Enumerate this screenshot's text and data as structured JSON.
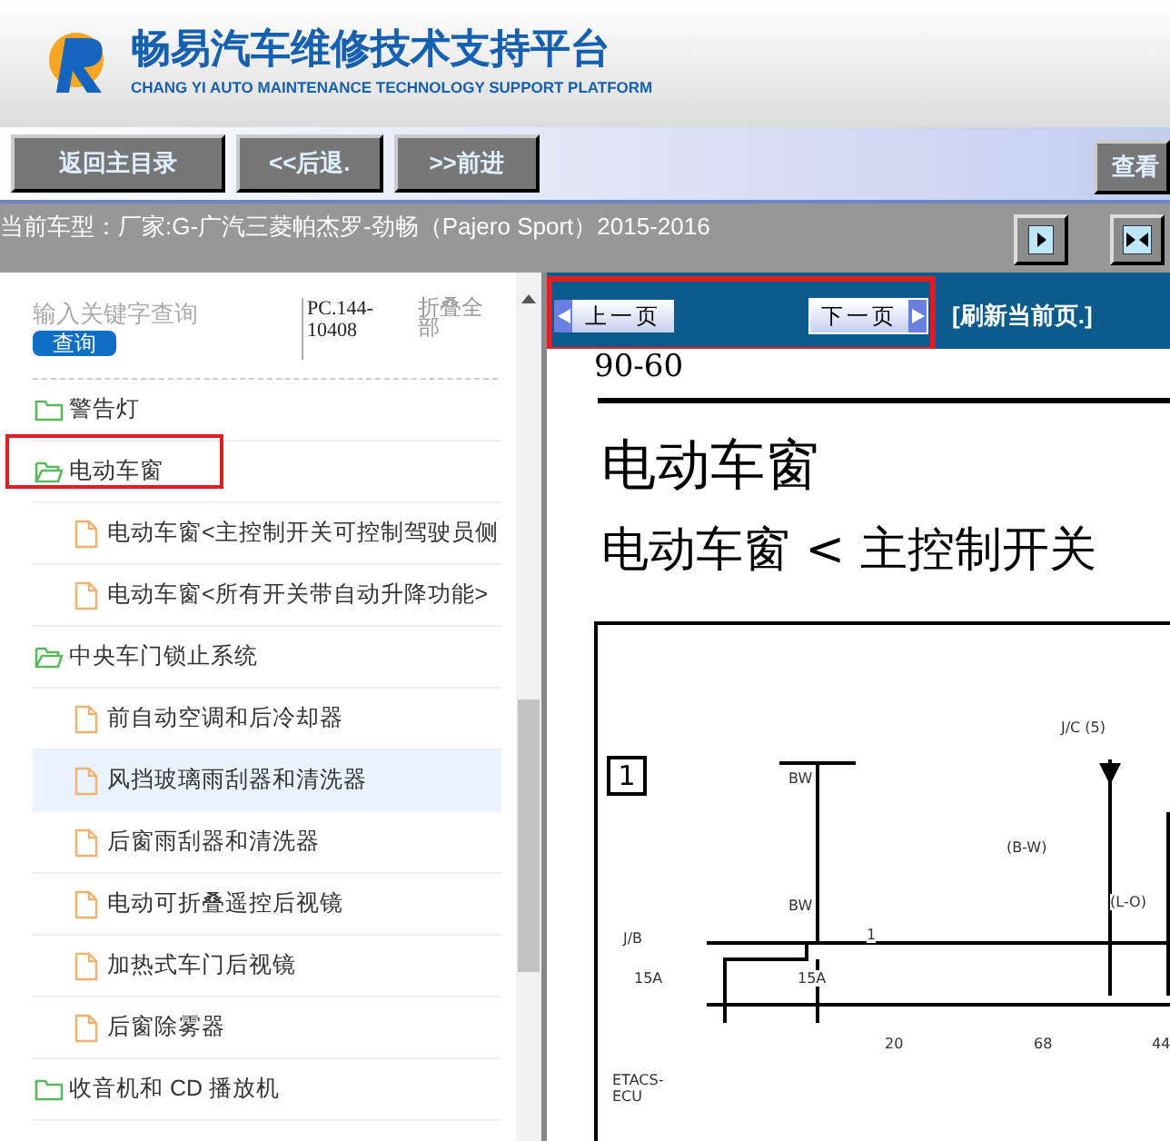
{
  "header": {
    "title": "畅易汽车维修技术支持平台",
    "subtitle": "CHANG YI AUTO MAINTENANCE TECHNOLOGY SUPPORT PLATFORM"
  },
  "nav_buttons": [
    "返回主目录",
    "<<后退.",
    ">>前进"
  ],
  "right_button": "查看",
  "vehicle": {
    "label": "当前车型：",
    "value": "厂家:G-广汽三菱帕杰罗-劲畅（Pajero Sport）2015-2016"
  },
  "sidebar": {
    "search": {
      "placeholder": "输入关键字查询",
      "button": "查询"
    },
    "code": "PC.144-10408",
    "collapse": "折叠全部",
    "items": [
      {
        "kind": "folder",
        "label": "警告灯",
        "expanded": false,
        "highlighted": false,
        "selected": false
      },
      {
        "kind": "folder",
        "label": "电动车窗",
        "expanded": true,
        "highlighted": true,
        "selected": false,
        "children": [
          {
            "kind": "page",
            "label": "电动车窗<主控制开关可控制驾驶员侧",
            "selected": false
          },
          {
            "kind": "page",
            "label": "电动车窗<所有开关带自动升降功能>",
            "selected": false
          }
        ]
      },
      {
        "kind": "folder",
        "label": "中央车门锁止系统",
        "expanded": true,
        "highlighted": false,
        "selected": false,
        "children": [
          {
            "kind": "page",
            "label": "前自动空调和后冷却器",
            "selected": false
          },
          {
            "kind": "page",
            "label": "风挡玻璃雨刮器和清洗器",
            "selected": true
          },
          {
            "kind": "page",
            "label": "后窗雨刮器和清洗器",
            "selected": false
          },
          {
            "kind": "page",
            "label": "电动可折叠遥控后视镜",
            "selected": false
          },
          {
            "kind": "page",
            "label": "加热式车门后视镜",
            "selected": false
          },
          {
            "kind": "page",
            "label": "后窗除雾器",
            "selected": false
          }
        ]
      },
      {
        "kind": "folder",
        "label": "收音机和 CD 播放机",
        "expanded": false,
        "highlighted": false,
        "selected": false
      }
    ]
  },
  "viewer": {
    "prev": "上一页",
    "next": "下一页",
    "refresh": "[刷新当前页.]",
    "page": {
      "number": "90-60",
      "title": "电动车窗",
      "subtitle": "电动车窗 < 主控制开关",
      "diagram": {
        "section": "1",
        "labels": [
          "J/C (5)",
          "BW",
          "BW",
          "(B-W)",
          "(L-O)",
          "J/B",
          "15A",
          "15A",
          "1",
          "20",
          "68",
          "44",
          "ETACS-ECU"
        ]
      }
    }
  }
}
